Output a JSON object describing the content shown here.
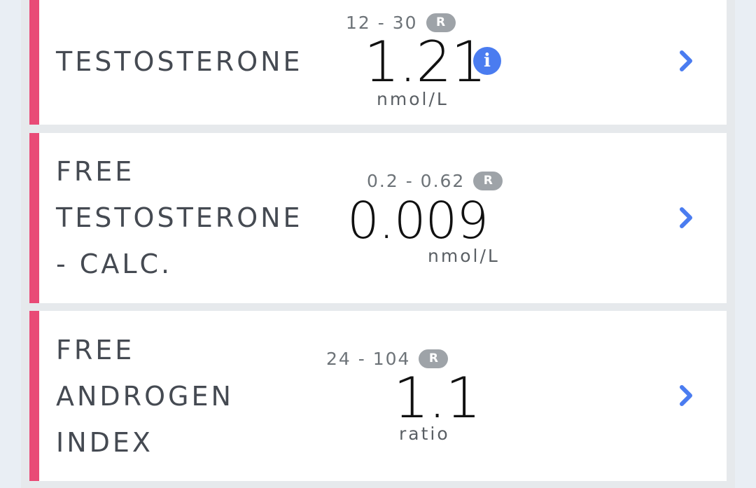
{
  "results": [
    {
      "name_lines": [
        "TESTOSTERONE"
      ],
      "range": "12 - 30",
      "range_badge": "R",
      "value": "1.21",
      "unit": "nmol/L",
      "has_info": true
    },
    {
      "name_lines": [
        "FREE",
        "TESTOSTERONE",
        "- CALC."
      ],
      "range": "0.2 - 0.62",
      "range_badge": "R",
      "value": "0.009",
      "unit": "nmol/L",
      "has_info": false
    },
    {
      "name_lines": [
        "FREE",
        "ANDROGEN",
        "INDEX"
      ],
      "range": "24 - 104",
      "range_badge": "R",
      "value": "1.1",
      "unit": "ratio",
      "has_info": false
    }
  ],
  "colors": {
    "flag_bar": "#e94a76",
    "accent": "#4a7cf0",
    "badge": "#9ea3a8"
  },
  "icons": {
    "info": "info-icon",
    "chevron": "chevron-right-icon"
  }
}
